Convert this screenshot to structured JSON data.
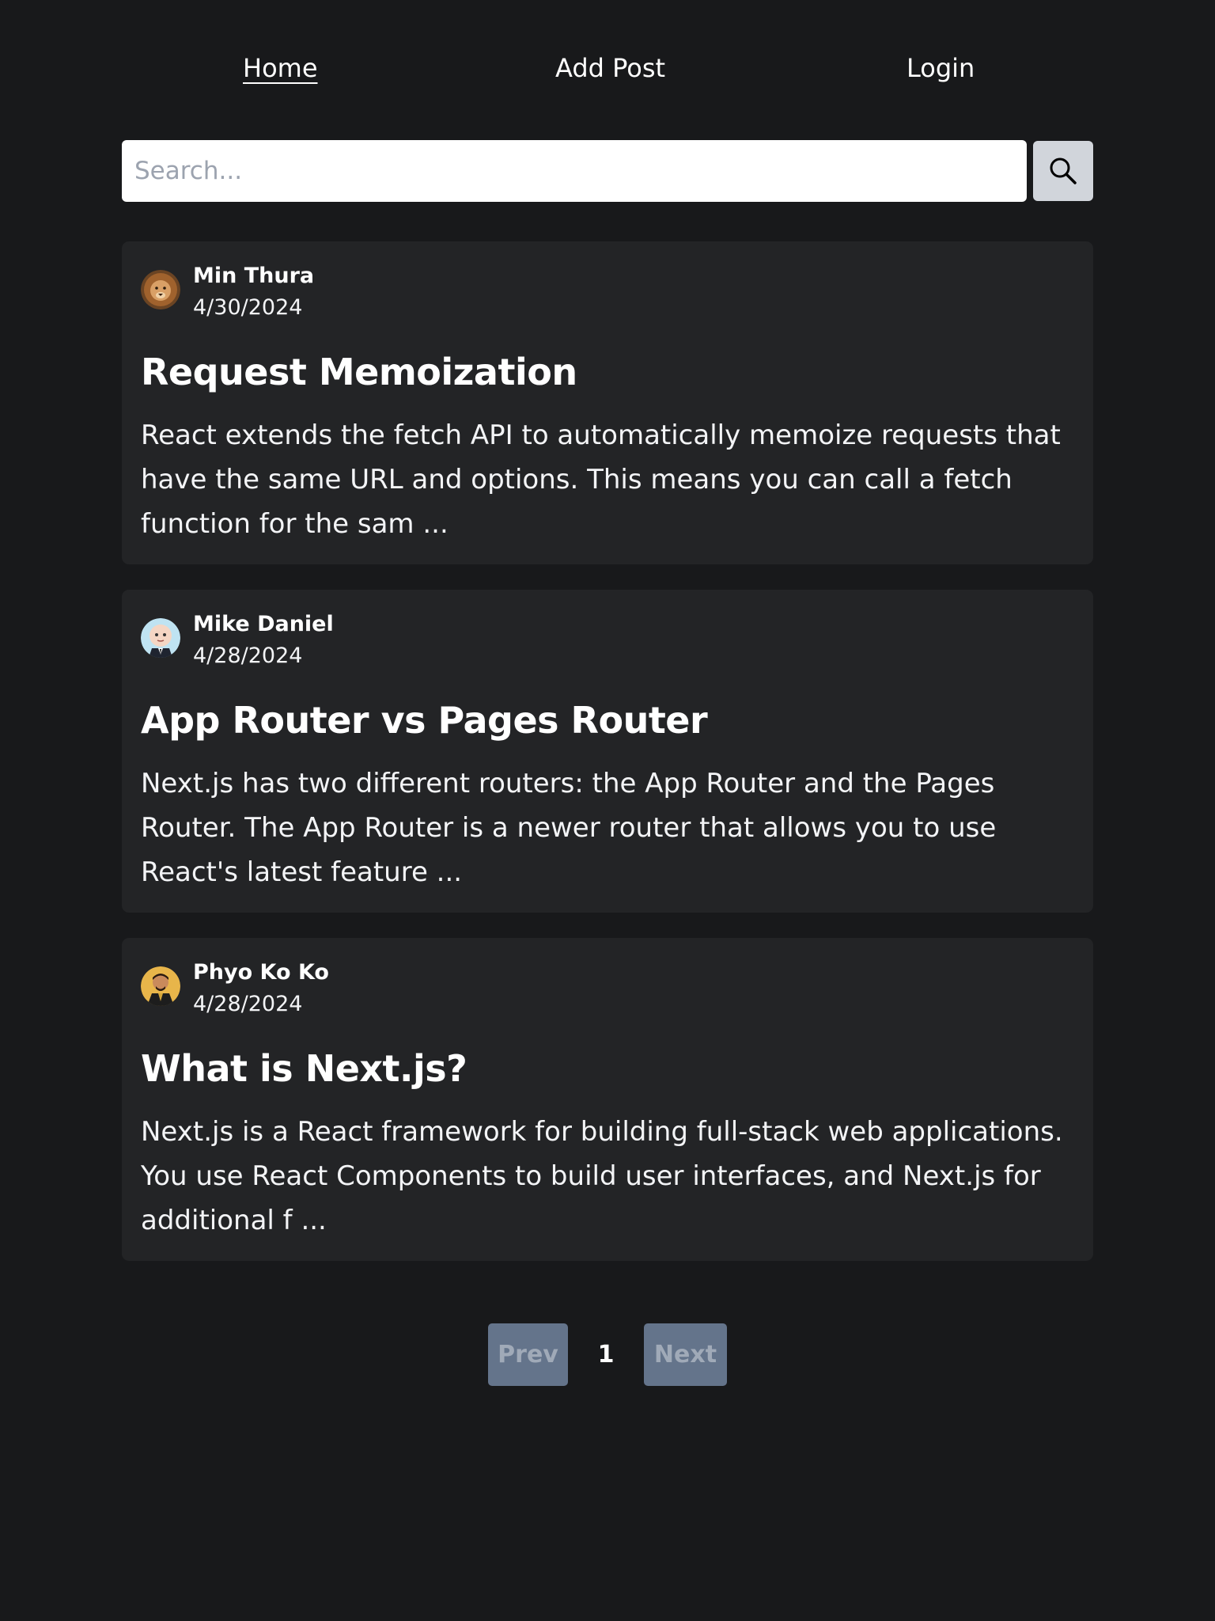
{
  "nav": {
    "items": [
      {
        "label": "Home",
        "active": true
      },
      {
        "label": "Add Post",
        "active": false
      },
      {
        "label": "Login",
        "active": false
      }
    ]
  },
  "search": {
    "placeholder": "Search...",
    "value": "",
    "button_icon": "search-icon"
  },
  "posts": [
    {
      "author": "Min Thura",
      "date": "4/30/2024",
      "avatar": "lion-avatar",
      "title": "Request Memoization",
      "excerpt": "React extends the fetch API to automatically memoize requests that have the same URL and options. This means you can call a fetch function for the sam ..."
    },
    {
      "author": "Mike Daniel",
      "date": "4/28/2024",
      "avatar": "baby-boss-avatar",
      "title": "App Router vs Pages Router",
      "excerpt": "Next.js has two different routers: the App Router and the Pages Router. The App Router is a newer router that allows you to use React's latest feature ..."
    },
    {
      "author": "Phyo Ko Ko",
      "date": "4/28/2024",
      "avatar": "person-avatar",
      "title": "What is Next.js?",
      "excerpt": "Next.js is a React framework for building full-stack web applications. You use React Components to build user interfaces, and Next.js for additional f ..."
    }
  ],
  "pagination": {
    "prev_label": "Prev",
    "current_page": "1",
    "next_label": "Next"
  },
  "colors": {
    "background": "#18191b",
    "card": "#232426",
    "pager_button": "#64748b",
    "search_button": "#d1d5db"
  }
}
